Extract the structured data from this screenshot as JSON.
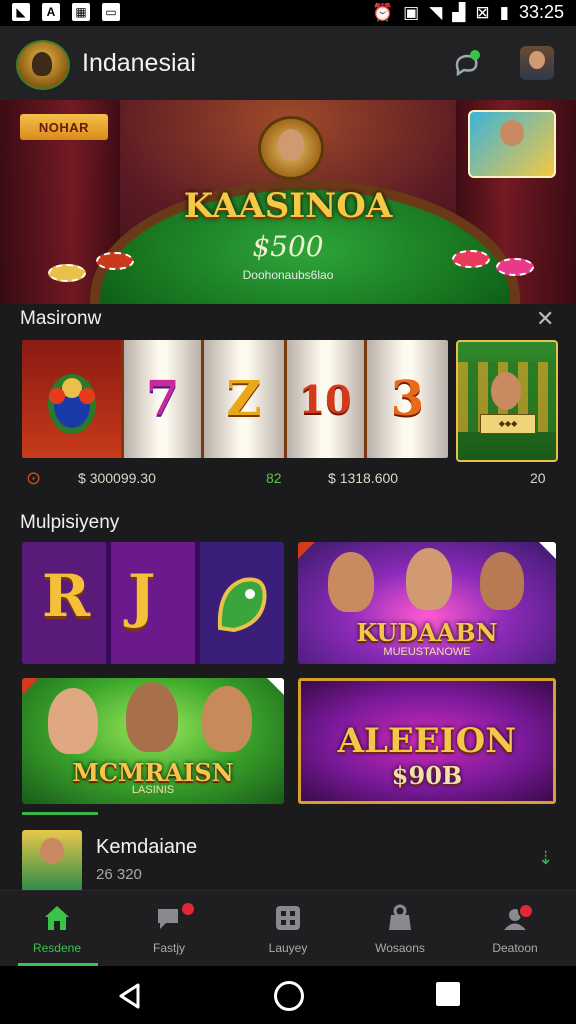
{
  "status_bar": {
    "time": "33:25"
  },
  "header": {
    "title": "Indanesiai"
  },
  "hero": {
    "tag": "NOHAR",
    "title": "KAASINOA",
    "amount": "$500",
    "subtitle": "Doohonaubs6lao"
  },
  "slots_section": {
    "title": "Masironw",
    "reels": [
      "7",
      "Z",
      "10",
      "3"
    ],
    "stats": {
      "left_value": "300099.30",
      "mid_value": "82",
      "right_value": "1318.600",
      "count": "20"
    }
  },
  "multiplayer_section": {
    "title": "Mulpisiyeny",
    "tiles": [
      {
        "symbols": [
          "R",
          "J"
        ]
      },
      {
        "title": "KUDAABN",
        "subtitle": "MUEUSTANOWE"
      },
      {
        "title": "MCMRAISN",
        "subtitle": "LASINIS"
      },
      {
        "title": "ALEEION",
        "subtitle": "$90B"
      }
    ]
  },
  "list_item": {
    "title": "Kemdaiane",
    "subtitle": "26 320"
  },
  "bottom_nav": [
    {
      "label": "Resdene"
    },
    {
      "label": "Fastjy"
    },
    {
      "label": "Lauyey"
    },
    {
      "label": "Wosaons"
    },
    {
      "label": "Deatoon"
    }
  ],
  "colors": {
    "accent": "#3bc24a",
    "gold": "#f5c64a",
    "background": "#1b1b1d"
  }
}
